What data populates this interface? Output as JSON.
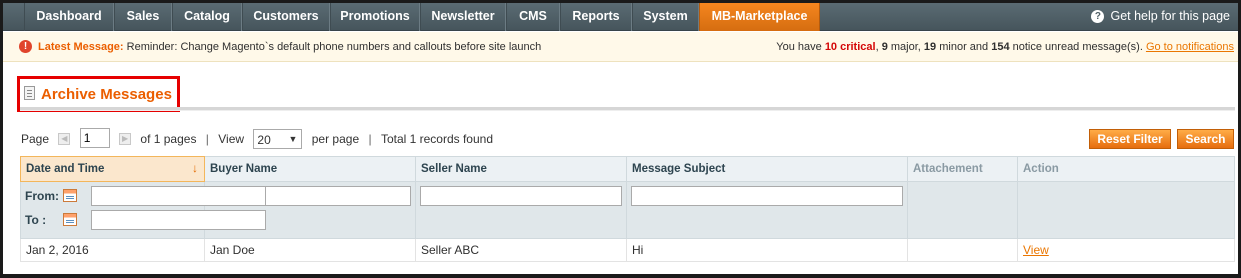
{
  "nav": {
    "items": [
      {
        "label": "Dashboard"
      },
      {
        "label": "Sales"
      },
      {
        "label": "Catalog"
      },
      {
        "label": "Customers"
      },
      {
        "label": "Promotions"
      },
      {
        "label": "Newsletter"
      },
      {
        "label": "CMS"
      },
      {
        "label": "Reports"
      },
      {
        "label": "System"
      },
      {
        "label": "MB-Marketplace",
        "active": true
      }
    ],
    "help": "Get help for this page"
  },
  "notice": {
    "latest_label": "Latest Message:",
    "latest_text": "Reminder: Change Magento`s default phone numbers and callouts before site launch",
    "summary_prefix": "You have",
    "critical": "10 critical",
    "major": "9",
    "major_label": "major,",
    "minor": "19",
    "minor_label": "minor and",
    "notice": "154",
    "notice_label": "notice unread message(s).",
    "link": "Go to notifications"
  },
  "page": {
    "title": "Archive Messages"
  },
  "pager": {
    "page_label": "Page",
    "page_value": "1",
    "of_pages": "of 1 pages",
    "view_label": "View",
    "view_value": "20",
    "per_page": "per page",
    "total": "Total 1 records found"
  },
  "buttons": {
    "reset": "Reset Filter",
    "search": "Search"
  },
  "grid": {
    "columns": [
      "Date and Time",
      "Buyer Name",
      "Seller Name",
      "Message Subject",
      "Attachement",
      "Action"
    ],
    "filters": {
      "from_label": "From:",
      "to_label": "To :"
    },
    "rows": [
      {
        "date": "Jan 2, 2016",
        "buyer": "Jan Doe",
        "seller": "Seller ABC",
        "subject": "Hi",
        "attachment": "",
        "action": "View"
      }
    ]
  },
  "colors": {
    "accent": "#eb5e00",
    "nav_bg": "#4f5f66",
    "highlight_box": "#e60000"
  }
}
